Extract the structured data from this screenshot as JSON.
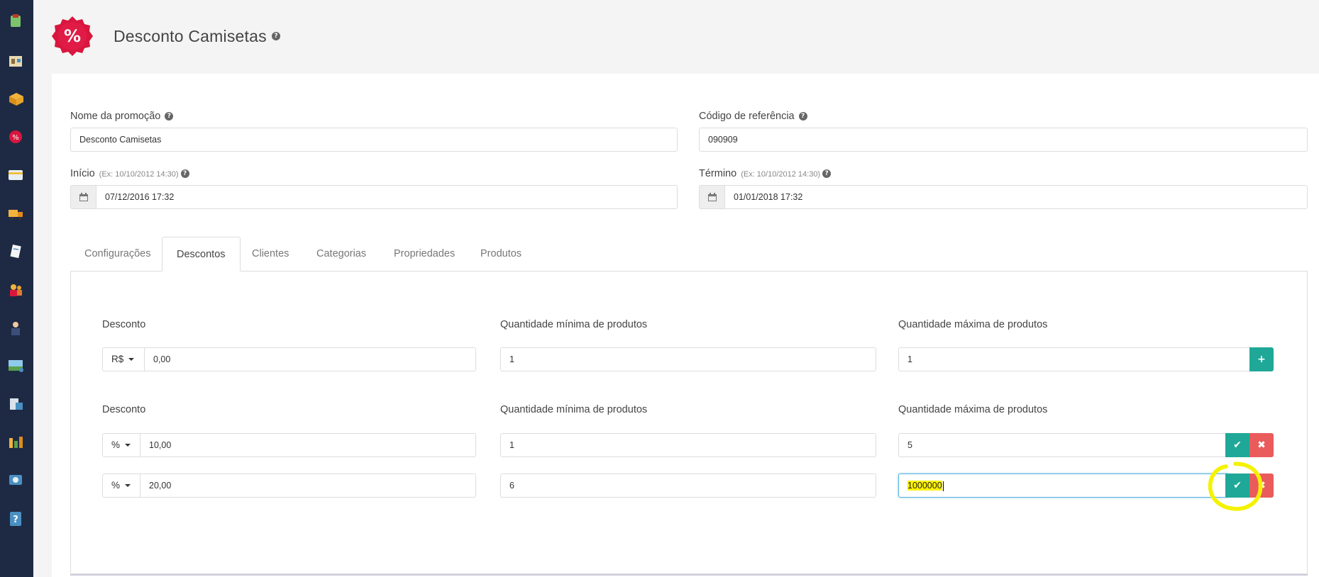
{
  "header": {
    "title": "Desconto Camisetas",
    "badge_symbol": "%",
    "badge_color": "#d8163e"
  },
  "form": {
    "nome_label": "Nome da promoção",
    "nome_value": "Desconto Camisetas",
    "codigo_label": "Código de referência",
    "codigo_value": "090909",
    "inicio_label": "Início",
    "inicio_hint": "(Ex: 10/10/2012 14:30)",
    "inicio_value": "07/12/2016 17:32",
    "termino_label": "Término",
    "termino_hint": "(Ex: 10/10/2012 14:30)",
    "termino_value": "01/01/2018 17:32"
  },
  "tabs": [
    {
      "label": "Configurações"
    },
    {
      "label": "Descontos"
    },
    {
      "label": "Clientes"
    },
    {
      "label": "Categorias"
    },
    {
      "label": "Propriedades"
    },
    {
      "label": "Produtos"
    }
  ],
  "active_tab": "Descontos",
  "discounts": {
    "new_row": {
      "desconto_label": "Desconto",
      "min_label": "Quantidade mínima de produtos",
      "max_label": "Quantidade máxima de produtos",
      "type": "R$",
      "value": "0,00",
      "min": "1",
      "max": "1",
      "add_symbol": "+"
    },
    "list_labels": {
      "desconto_label": "Desconto",
      "min_label": "Quantidade mínima de produtos",
      "max_label": "Quantidade máxima de produtos"
    },
    "rows": [
      {
        "type": "%",
        "value": "10,00",
        "min": "1",
        "max": "5"
      },
      {
        "type": "%",
        "value": "20,00",
        "min": "6",
        "max": "1000000"
      }
    ],
    "confirm_symbol": "✔",
    "remove_symbol": "✖"
  },
  "colors": {
    "sidebar": "#1e2a44",
    "teal": "#1fa898",
    "red": "#ea5b5b",
    "highlight": "#fff200"
  }
}
